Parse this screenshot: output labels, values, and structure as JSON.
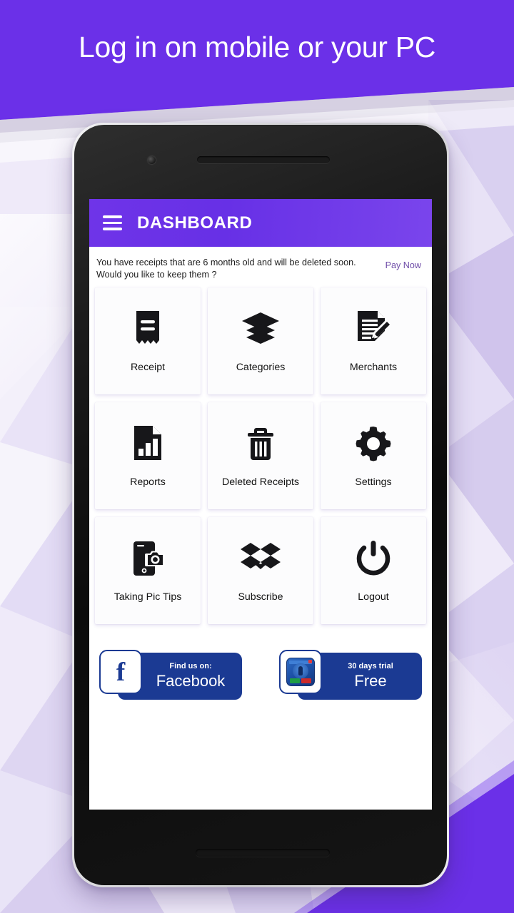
{
  "promo_headline": "Log in on mobile or your PC",
  "colors": {
    "brand_purple": "#6b30e8",
    "appbar_purple": "#6f34e8",
    "pay_now": "#6f4da8",
    "promo_blue": "#1b3a93",
    "background_light": "#efe9fa"
  },
  "phone": {
    "camera": "front-camera",
    "earpiece": "earpiece-speaker"
  },
  "appbar": {
    "menu_icon": "hamburger-menu-icon",
    "title": "DASHBOARD"
  },
  "banner": {
    "line1": "You have receipts that are 6 months old and will be deleted soon.",
    "line2": "Would you like to keep them ?",
    "action_label": "Pay Now"
  },
  "grid": {
    "tiles": [
      {
        "label": "Receipt",
        "icon": "receipt-icon"
      },
      {
        "label": "Categories",
        "icon": "layers-icon"
      },
      {
        "label": "Merchants",
        "icon": "document-pencil-icon"
      },
      {
        "label": "Reports",
        "icon": "chart-document-icon"
      },
      {
        "label": "Deleted Receipts",
        "icon": "trash-icon"
      },
      {
        "label": "Settings",
        "icon": "gear-icon"
      },
      {
        "label": "Taking Pic Tips",
        "icon": "phone-camera-icon"
      },
      {
        "label": "Subscribe",
        "icon": "dropbox-box-icon"
      },
      {
        "label": "Logout",
        "icon": "power-icon"
      }
    ]
  },
  "promos": [
    {
      "badge_icon": "facebook-f-icon",
      "subtitle": "Find us on:",
      "title": "Facebook"
    },
    {
      "badge_icon": "app-store-icon",
      "subtitle": "30 days trial",
      "title": "Free"
    }
  ]
}
